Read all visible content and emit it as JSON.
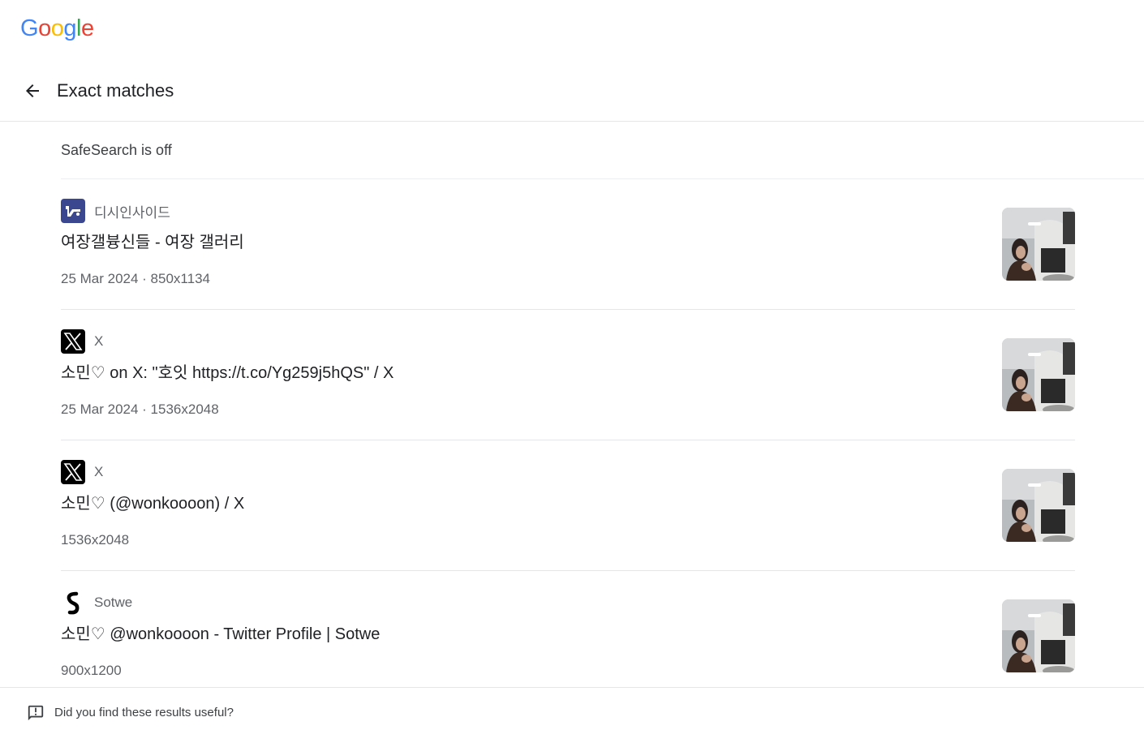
{
  "logo": {
    "letters": [
      "G",
      "o",
      "o",
      "g",
      "l",
      "e"
    ],
    "colors": [
      "#4285F4",
      "#EA4335",
      "#FBBC05",
      "#4285F4",
      "#34A853",
      "#EA4335"
    ]
  },
  "header": {
    "title": "Exact matches",
    "back_icon": "arrow-back-icon"
  },
  "safesearch": {
    "label": "SafeSearch is off"
  },
  "results": [
    {
      "source": "디시인사이드",
      "favicon": "dcinside-icon",
      "title": "여장갤븅신들 - 여장 갤러리",
      "meta": "25 Mar 2024 · 850x1134"
    },
    {
      "source": "X",
      "favicon": "x-logo-icon",
      "title": "소민♡ on X: \"호잇 https://t.co/Yg259j5hQS\" / X",
      "meta": "25 Mar 2024 · 1536x2048"
    },
    {
      "source": "X",
      "favicon": "x-logo-icon",
      "title": "소민♡ (@wonkoooon) / X",
      "meta": "1536x2048"
    },
    {
      "source": "Sotwe",
      "favicon": "sotwe-icon",
      "title": "소민♡ @wonkoooon - Twitter Profile | Sotwe",
      "meta": "900x1200"
    }
  ],
  "footer": {
    "feedback_label": "Did you find these results useful?",
    "feedback_icon": "feedback-icon"
  },
  "colors": {
    "text_primary": "#202124",
    "text_secondary": "#5f6368",
    "divider": "#e4e6e9",
    "dcinside_blue": "#3b4890"
  }
}
